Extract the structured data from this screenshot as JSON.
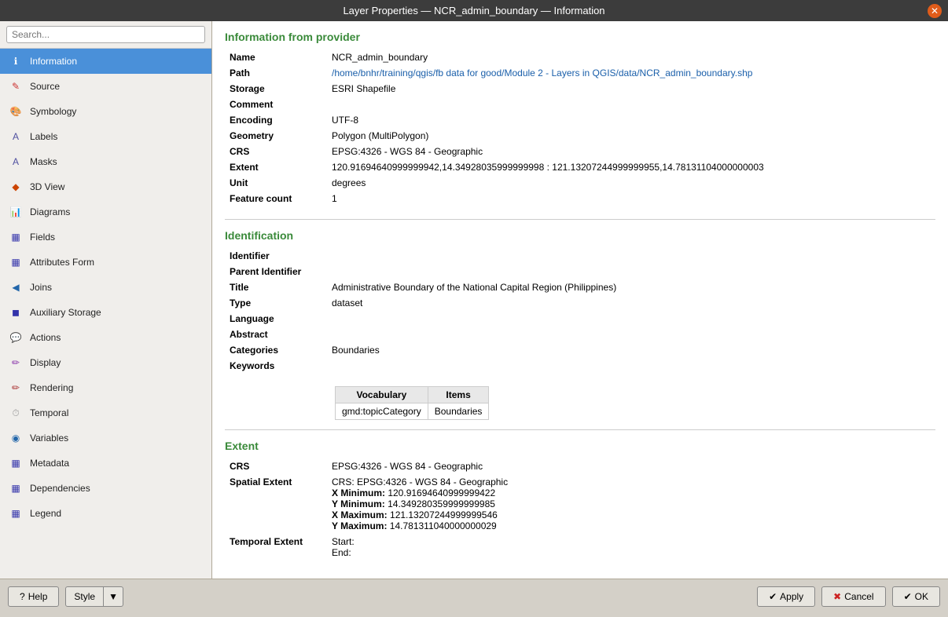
{
  "titleBar": {
    "title": "Layer Properties — NCR_admin_boundary — Information"
  },
  "sidebar": {
    "search": {
      "placeholder": "Search..."
    },
    "items": [
      {
        "id": "information",
        "label": "Information",
        "icon": "ℹ",
        "active": true
      },
      {
        "id": "source",
        "label": "Source",
        "icon": "✎"
      },
      {
        "id": "symbology",
        "label": "Symbology",
        "icon": "🎨"
      },
      {
        "id": "labels",
        "label": "Labels",
        "icon": "A"
      },
      {
        "id": "masks",
        "label": "Masks",
        "icon": "A"
      },
      {
        "id": "3dview",
        "label": "3D View",
        "icon": "◆"
      },
      {
        "id": "diagrams",
        "label": "Diagrams",
        "icon": "📊"
      },
      {
        "id": "fields",
        "label": "Fields",
        "icon": "▦"
      },
      {
        "id": "attributesform",
        "label": "Attributes Form",
        "icon": "▦"
      },
      {
        "id": "joins",
        "label": "Joins",
        "icon": "◀"
      },
      {
        "id": "auxiliarystorage",
        "label": "Auxiliary Storage",
        "icon": "◼"
      },
      {
        "id": "actions",
        "label": "Actions",
        "icon": "💬"
      },
      {
        "id": "display",
        "label": "Display",
        "icon": "✏"
      },
      {
        "id": "rendering",
        "label": "Rendering",
        "icon": "✏"
      },
      {
        "id": "temporal",
        "label": "Temporal",
        "icon": "⏱"
      },
      {
        "id": "variables",
        "label": "Variables",
        "icon": "◉"
      },
      {
        "id": "metadata",
        "label": "Metadata",
        "icon": "▦"
      },
      {
        "id": "dependencies",
        "label": "Dependencies",
        "icon": "▦"
      },
      {
        "id": "legend",
        "label": "Legend",
        "icon": "▦"
      }
    ]
  },
  "content": {
    "informationFromProvider": {
      "sectionTitle": "Information from provider",
      "fields": [
        {
          "label": "Name",
          "value": "NCR_admin_boundary",
          "isLink": false
        },
        {
          "label": "Path",
          "value": "/home/bnhr/training/qgis/fb data for good/Module 2 - Layers in QGIS/data/NCR_admin_boundary.shp",
          "isLink": true
        },
        {
          "label": "Storage",
          "value": "ESRI Shapefile",
          "isLink": false
        },
        {
          "label": "Comment",
          "value": "",
          "isLink": false
        },
        {
          "label": "Encoding",
          "value": "UTF-8",
          "isLink": false
        },
        {
          "label": "Geometry",
          "value": "Polygon (MultiPolygon)",
          "isLink": false
        },
        {
          "label": "CRS",
          "value": "EPSG:4326 - WGS 84 - Geographic",
          "isLink": false
        },
        {
          "label": "Extent",
          "value": "120.91694640999999942,14.34928035999999998 : 121.13207244999999955,14.78131104000000003",
          "isLink": false
        },
        {
          "label": "Unit",
          "value": "degrees",
          "isLink": false
        },
        {
          "label": "Feature count",
          "value": "1",
          "isLink": false
        }
      ]
    },
    "identification": {
      "sectionTitle": "Identification",
      "fields": [
        {
          "label": "Identifier",
          "value": ""
        },
        {
          "label": "Parent Identifier",
          "value": ""
        },
        {
          "label": "Title",
          "value": "Administrative Boundary of the National Capital Region (Philippines)"
        },
        {
          "label": "Type",
          "value": "dataset"
        },
        {
          "label": "Language",
          "value": ""
        },
        {
          "label": "Abstract",
          "value": ""
        },
        {
          "label": "Categories",
          "value": "Boundaries"
        },
        {
          "label": "Keywords",
          "value": ""
        }
      ],
      "keywords": {
        "headers": [
          "Vocabulary",
          "Items"
        ],
        "rows": [
          {
            "vocabulary": "gmd:topicCategory",
            "items": "Boundaries"
          }
        ]
      }
    },
    "extent": {
      "sectionTitle": "Extent",
      "fields": [
        {
          "label": "CRS",
          "value": "EPSG:4326 - WGS 84 - Geographic"
        },
        {
          "label": "Spatial Extent",
          "value": ""
        }
      ],
      "spatialExtent": {
        "crs": "CRS: EPSG:4326 - WGS 84 - Geographic",
        "xMin": "X Minimum: 120.91694640999999422",
        "yMin": "Y Minimum: 14.349280359999999985",
        "xMax": "X Maximum: 121.13207244999999546",
        "yMax": "Y Maximum: 14.781311040000000029"
      },
      "temporalExtent": {
        "label": "Temporal Extent",
        "start": "Start:",
        "end": "End:"
      }
    }
  },
  "bottomBar": {
    "helpLabel": "Help",
    "styleLabel": "Style",
    "applyLabel": "Apply",
    "cancelLabel": "Cancel",
    "okLabel": "OK"
  }
}
